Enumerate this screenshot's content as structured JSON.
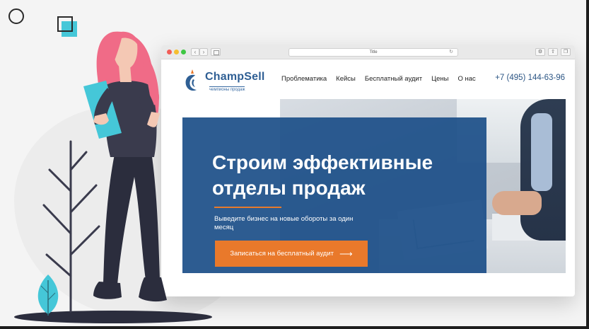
{
  "browser": {
    "tab_title": "Title"
  },
  "site": {
    "logo_name": "ChampSell",
    "logo_tagline": "чемпионы продаж",
    "nav": [
      {
        "label": "Проблематика"
      },
      {
        "label": "Кейсы"
      },
      {
        "label": "Бесплатный аудит"
      },
      {
        "label": "Цены"
      },
      {
        "label": "О нас"
      }
    ],
    "phone": "+7 (495) 144-63-96"
  },
  "hero": {
    "title": "Строим эффективные отделы продаж",
    "subtitle": "Выведите бизнес на новые обороты за один месяц",
    "cta_label": "Записаться на бесплатный аудит",
    "cta_arrow": "⟶"
  },
  "colors": {
    "brand_blue": "#2f5f94",
    "panel_blue": "#1d5089",
    "accent_orange": "#e9792b",
    "accent_teal": "#45c7d8",
    "hair_pink": "#f06b87"
  }
}
